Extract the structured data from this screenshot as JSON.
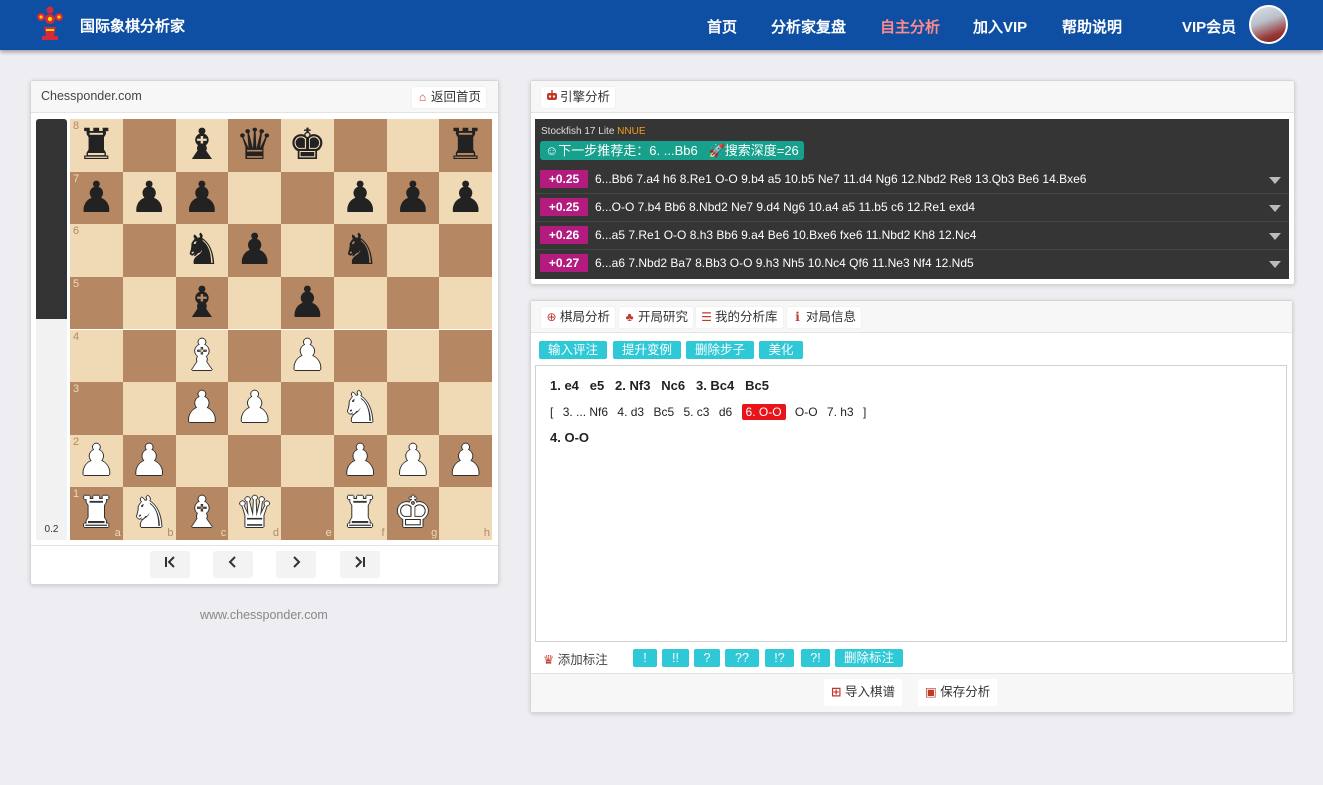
{
  "nav": {
    "brand": "国际象棋分析家",
    "items": [
      {
        "label": "首页",
        "active": false
      },
      {
        "label": "分析家复盘",
        "active": false
      },
      {
        "label": "自主分析",
        "active": true
      },
      {
        "label": "加入VIP",
        "active": false
      },
      {
        "label": "帮助说明",
        "active": false
      },
      {
        "label": "VIP会员",
        "active": false
      }
    ]
  },
  "board_panel": {
    "site_label": "Chessponder.com",
    "home_button": "返回首页",
    "eval_value": "0.2",
    "ranks": [
      "8",
      "7",
      "6",
      "5",
      "4",
      "3",
      "2",
      "1"
    ],
    "files": [
      "a",
      "b",
      "c",
      "d",
      "e",
      "f",
      "g",
      "h"
    ],
    "position": [
      [
        "r",
        "",
        "b",
        "q",
        "k",
        "",
        "",
        "r"
      ],
      [
        "p",
        "p",
        "p",
        "",
        "",
        "p",
        "p",
        "p"
      ],
      [
        "",
        "",
        "n",
        "p",
        "",
        "n",
        "",
        ""
      ],
      [
        "",
        "",
        "b",
        "",
        "p",
        "",
        "",
        ""
      ],
      [
        "",
        "",
        "B",
        "",
        "P",
        "",
        "",
        ""
      ],
      [
        "",
        "",
        "P",
        "P",
        "",
        "N",
        "",
        ""
      ],
      [
        "P",
        "P",
        "",
        "",
        "",
        "P",
        "P",
        "P"
      ],
      [
        "R",
        "N",
        "B",
        "Q",
        "",
        "R",
        "K",
        ""
      ]
    ],
    "footer_link": "www.chessponder.com"
  },
  "engine": {
    "tab_label": "引擎分析",
    "engine_name": "Stockfish 17 Lite",
    "engine_tag": "NNUE",
    "recommend": "下一步推荐走：6. ...Bb6",
    "depth": "搜索深度=26",
    "lines": [
      {
        "score": "+0.25",
        "moves": "6...Bb6  7.a4  h6  8.Re1  O-O  9.b4  a5  10.b5  Ne7  11.d4  Ng6  12.Nbd2  Re8  13.Qb3  Be6  14.Bxe6"
      },
      {
        "score": "+0.25",
        "moves": "6...O-O  7.b4  Bb6  8.Nbd2  Ne7  9.d4  Ng6  10.a4  a5  11.b5  c6  12.Re1  exd4"
      },
      {
        "score": "+0.26",
        "moves": "6...a5  7.Re1  O-O  8.h3  Bb6  9.a4  Be6  10.Bxe6  fxe6  11.Nbd2  Kh8  12.Nc4"
      },
      {
        "score": "+0.27",
        "moves": "6...a6  7.Nbd2  Ba7  8.Bb3  O-O  9.h3  Nh5  10.Nc4  Qf6  11.Ne3  Nf4  12.Nd5"
      }
    ]
  },
  "analysis": {
    "tabs": [
      "棋局分析",
      "开局研究",
      "我的分析库",
      "对局信息"
    ],
    "tools": [
      "输入评注",
      "提升变例",
      "删除步子",
      "美化"
    ],
    "mainline1": "1. e4   e5   2. Nf3   Nc6   3. Bc4   Bc5",
    "variation": {
      "open": "[",
      "moves_before": [
        "3. ... Nf6",
        "4. d3",
        "Bc5",
        "5. c3",
        "d6"
      ],
      "highlighted": "6. O-O",
      "moves_after": [
        "O-O",
        "7. h3"
      ],
      "close": "]"
    },
    "mainline2": "4. O-O",
    "annot_label": "添加标注",
    "annot_buttons": [
      "!",
      "!!",
      "?",
      "??",
      "!?",
      "?!",
      "删除标注"
    ],
    "import_button": "导入棋谱",
    "save_button": "保存分析"
  }
}
